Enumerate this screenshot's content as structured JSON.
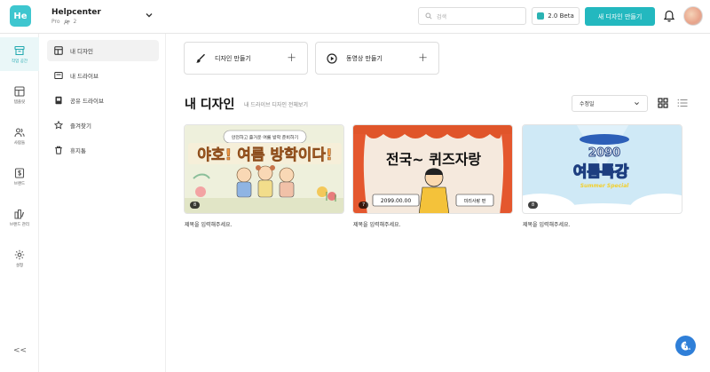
{
  "workspace": {
    "logo_text": "He",
    "name": "Helpcenter",
    "plan": "Pro",
    "member_count": "2"
  },
  "search": {
    "placeholder": "검색"
  },
  "header": {
    "beta_label": "2.0 Beta",
    "new_design_label": "새 디자인 만들기"
  },
  "rail": {
    "items": [
      {
        "label": "작업 공간",
        "icon": "archive-icon"
      },
      {
        "label": "템플릿",
        "icon": "layout-icon"
      },
      {
        "label": "사람들",
        "icon": "people-icon"
      },
      {
        "label": "브랜드",
        "icon": "brand-icon"
      },
      {
        "label": "브랜드 관리",
        "icon": "brand-manage-icon"
      },
      {
        "label": "설정",
        "icon": "gear-icon"
      }
    ],
    "collapse_label": "<<"
  },
  "sidebar": {
    "items": [
      {
        "label": "내 디자인"
      },
      {
        "label": "내 드라이브"
      },
      {
        "label": "공유 드라이브"
      },
      {
        "label": "즐겨찾기"
      },
      {
        "label": "휴지통"
      }
    ]
  },
  "create": {
    "design_label": "디자인 만들기",
    "video_label": "동영상 만들기"
  },
  "section": {
    "title": "내 디자인",
    "subtitle": "내 드라이브 디자인 전체보기",
    "sort_label": "수정일"
  },
  "designs": [
    {
      "count": "8",
      "caption": "제목을 입력해주세요.",
      "banner_top": "안전하고 즐거운 여름 방학 준비하기",
      "banner_main": "야호! 여름 방학이다!"
    },
    {
      "count": "7",
      "caption": "제목을 입력해주세요.",
      "banner_main": "전국~ 퀴즈자랑",
      "date": "2099.00.00",
      "host": "미리사랑 편"
    },
    {
      "count": "8",
      "caption": "제목을 입력해주세요.",
      "banner_top": "2090",
      "banner_main": "여름특강",
      "banner_sub": "Summer Special"
    }
  ],
  "colors": {
    "accent": "#23b8bf",
    "help": "#2f7fd8"
  }
}
